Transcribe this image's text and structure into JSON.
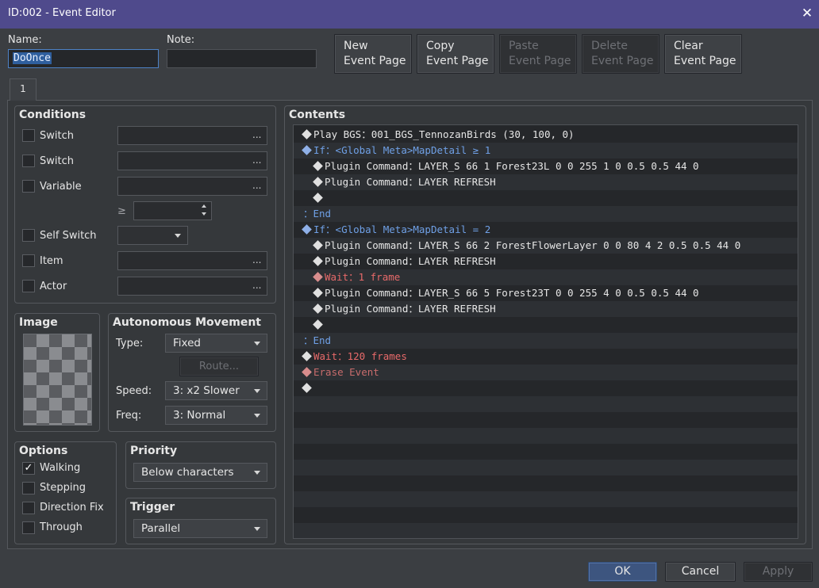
{
  "window": {
    "title": "ID:002 - Event Editor",
    "close_glyph": "✕"
  },
  "name": {
    "label": "Name:",
    "value": "DoOnce"
  },
  "note": {
    "label": "Note:",
    "value": ""
  },
  "toolbar": {
    "new_label": "New\nEvent Page",
    "copy_label": "Copy\nEvent Page",
    "paste_label": "Paste\nEvent Page",
    "delete_label": "Delete\nEvent Page",
    "clear_label": "Clear\nEvent Page"
  },
  "tabs": [
    {
      "label": "1"
    }
  ],
  "conditions": {
    "title": "Conditions",
    "switch1_label": "Switch",
    "switch2_label": "Switch",
    "variable_label": "Variable",
    "ge_symbol": "≥",
    "self_switch_label": "Self Switch",
    "item_label": "Item",
    "actor_label": "Actor",
    "ellipsis": "..."
  },
  "image": {
    "title": "Image"
  },
  "autonomous": {
    "title": "Autonomous Movement",
    "type_label": "Type:",
    "type_value": "Fixed",
    "route_label": "Route...",
    "speed_label": "Speed:",
    "speed_value": "3: x2 Slower",
    "freq_label": "Freq:",
    "freq_value": "3: Normal"
  },
  "options": {
    "title": "Options",
    "walking_label": "Walking",
    "walking_checked": true,
    "stepping_label": "Stepping",
    "direction_fix_label": "Direction Fix",
    "through_label": "Through",
    "check_glyph": "✓"
  },
  "priority": {
    "title": "Priority",
    "value": "Below characters"
  },
  "trigger": {
    "title": "Trigger",
    "value": "Parallel"
  },
  "contents": {
    "title": "Contents",
    "rows": [
      "Play BGS：001_BGS_TennozanBirds (30, 100, 0)",
      "If：<Global Meta>MapDetail ≥ 1",
      "Plugin Command：LAYER_S 66 1 Forest23L 0 0 255 1 0 0.5 0.5 44 0",
      "Plugin Command：LAYER REFRESH",
      "",
      "：End",
      "If：<Global Meta>MapDetail = 2",
      "Plugin Command：LAYER_S 66 2 ForestFlowerLayer 0 0 80 4 2 0.5 0.5 44 0",
      "Plugin Command：LAYER REFRESH",
      "Wait：1 frame",
      "Plugin Command：LAYER_S 66 5 Forest23T 0 0 255 4 0 0.5 0.5 44 0",
      "Plugin Command：LAYER REFRESH",
      "",
      "：End",
      "Wait：120 frames",
      "Erase Event",
      ""
    ]
  },
  "footer": {
    "ok_label": "OK",
    "cancel_label": "Cancel",
    "apply_label": "Apply"
  },
  "colors": {
    "titlebar": "#4f4a8c",
    "accent": "#3d557f",
    "wait": "#e86a6a",
    "branch": "#6fa0e6"
  }
}
